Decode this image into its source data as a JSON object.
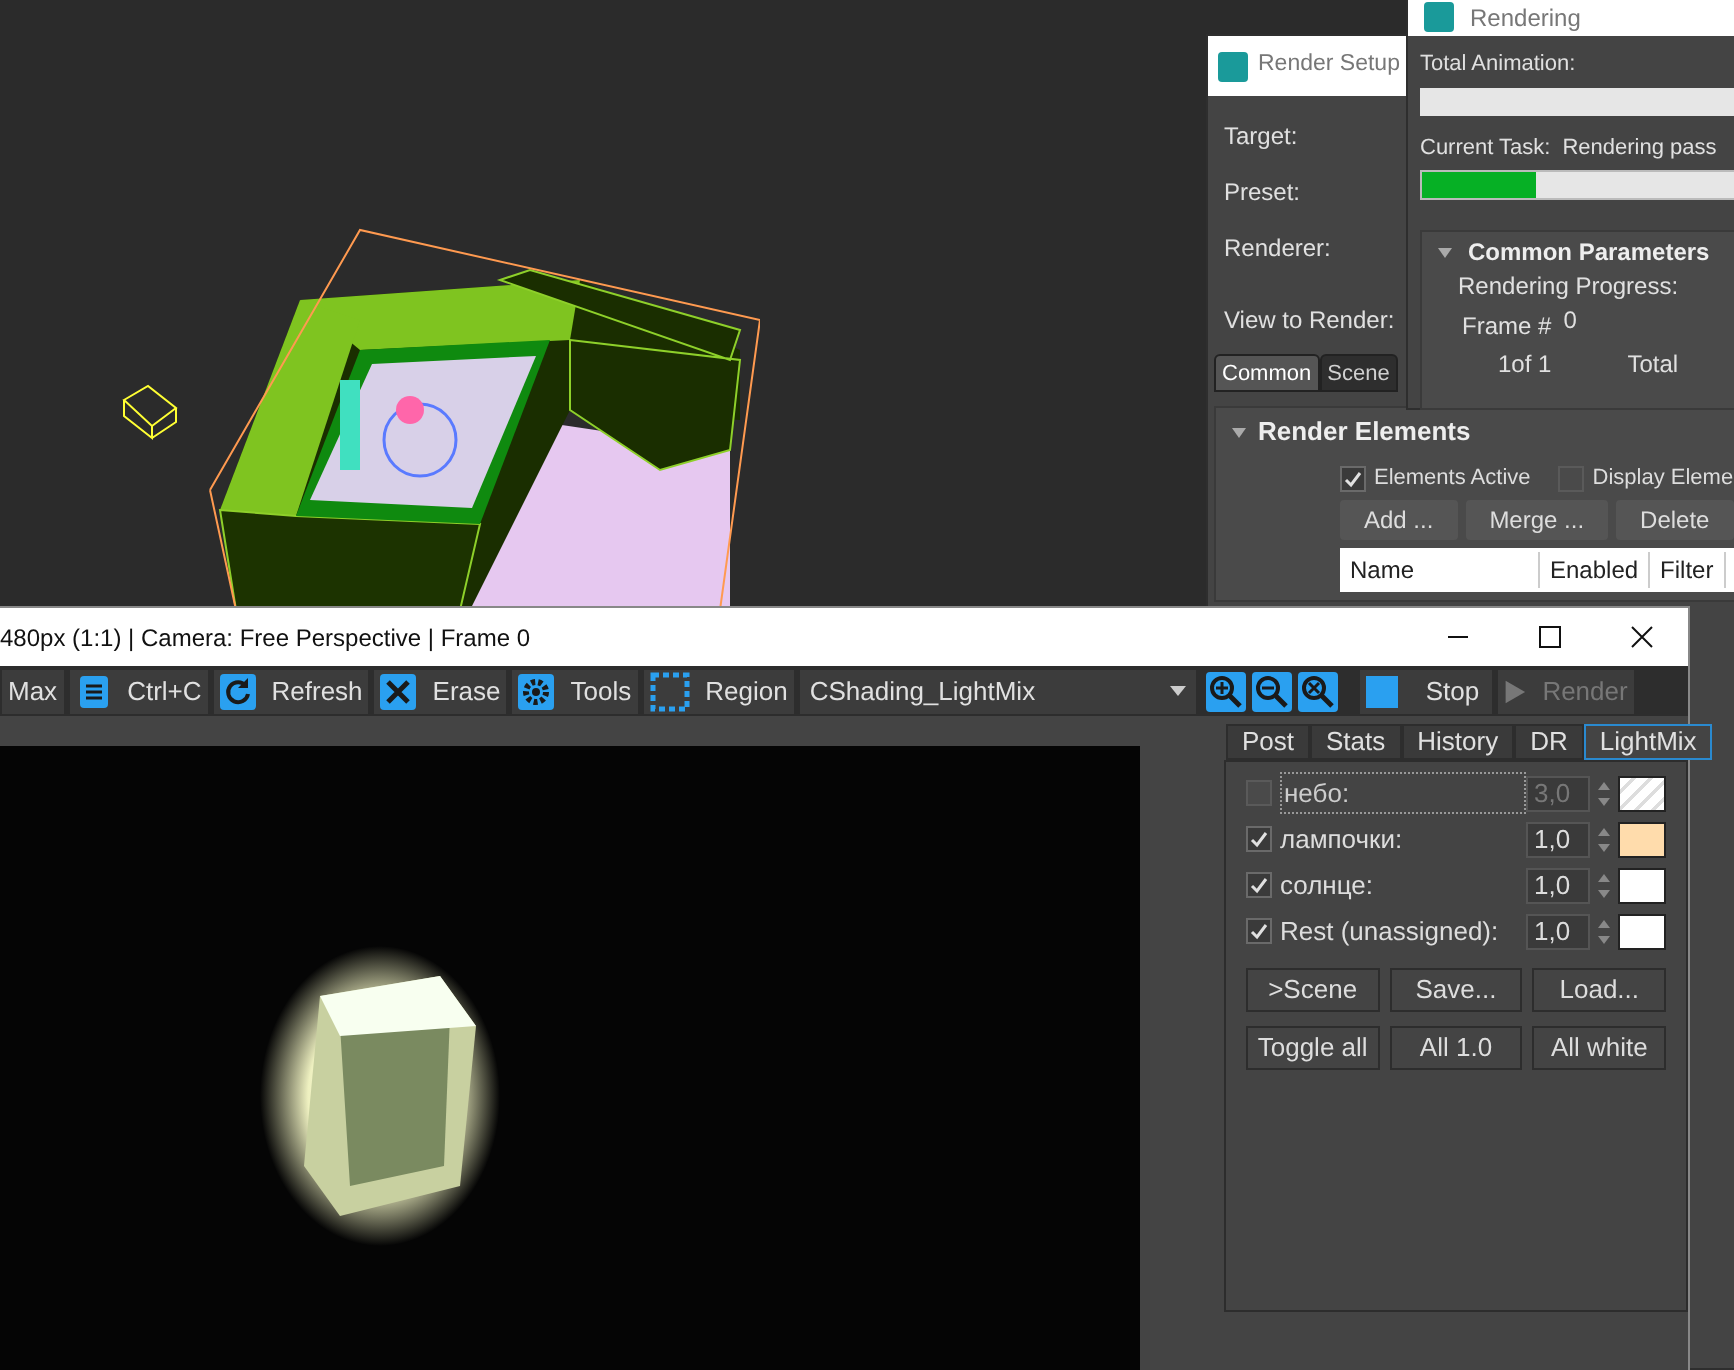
{
  "render_setup": {
    "title": "Render Setup",
    "fields": [
      "Target:",
      "Preset:",
      "Renderer:",
      "View to Render:"
    ],
    "tabs": [
      {
        "label": "Common",
        "selected": true
      },
      {
        "label": "Scene",
        "selected": false
      }
    ],
    "rollout": {
      "title": "Render Elements",
      "expanded": true,
      "elements_active": {
        "label": "Elements Active",
        "checked": true
      },
      "display_elements": {
        "label": "Display Eleme",
        "checked": false
      },
      "buttons": [
        "Add ...",
        "Merge ...",
        "Delete"
      ],
      "columns": [
        "Name",
        "Enabled",
        "Filter"
      ]
    }
  },
  "rendering": {
    "title": "Rendering",
    "total_animation": {
      "label": "Total Animation:",
      "level": 0
    },
    "current_task": {
      "label": "Current Task:",
      "value": "Rendering pass",
      "level": 0.3
    },
    "rollout": {
      "title": "Common Parameters",
      "expanded": true,
      "progress_label": "Rendering Progress:",
      "frame_label": "Frame #",
      "frame_value": "0",
      "count": "1of 1",
      "total": "Total"
    }
  },
  "frame_buffer": {
    "title": "480px (1:1) | Camera: Free Perspective | Frame 0",
    "toolbar": [
      {
        "kind": "text",
        "label": "Max"
      },
      {
        "kind": "clipboard",
        "label": "Ctrl+C"
      },
      {
        "kind": "refresh",
        "label": "Refresh"
      },
      {
        "kind": "erase",
        "label": "Erase"
      },
      {
        "kind": "gear",
        "label": "Tools"
      },
      {
        "kind": "region",
        "label": "Region"
      }
    ],
    "channel": "CShading_LightMix",
    "stop": "Stop",
    "render": {
      "label": "Render",
      "disabled": true
    },
    "tabs": [
      {
        "label": "Post",
        "selected": false
      },
      {
        "label": "Stats",
        "selected": false
      },
      {
        "label": "History",
        "selected": false
      },
      {
        "label": "DR",
        "selected": false
      },
      {
        "label": "LightMix",
        "selected": true
      }
    ],
    "lights": [
      {
        "name": "небо:",
        "checked": false,
        "value": "3,0",
        "color": "#ffffff"
      },
      {
        "name": "лампочки:",
        "checked": true,
        "value": "1,0",
        "color": "#ffdcac"
      },
      {
        "name": "солнце:",
        "checked": true,
        "value": "1,0",
        "color": "#ffffff"
      },
      {
        "name": "Rest (unassigned):",
        "checked": true,
        "value": "1,0",
        "color": "#ffffff"
      }
    ],
    "buttons": [
      ">Scene",
      "Save...",
      "Load...",
      "Toggle all",
      "All 1.0",
      "All white"
    ]
  }
}
